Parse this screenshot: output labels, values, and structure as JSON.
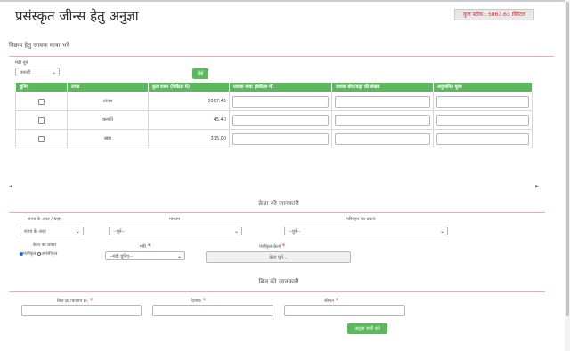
{
  "header": {
    "title": "प्रसंस्कृत जीन्स हेतु अनुज्ञा",
    "stock_badge": "कुल स्टॉक : 5867.63 क्विंटल"
  },
  "sale": {
    "section_title": "विक्रय हेतु जावक मात्रा भरें",
    "market_label": "मंडी चुनें",
    "market_value": "धमतरी",
    "show_button": "देखें",
    "columns": [
      "चुनिए",
      "उपज",
      "कुल वजन (क्विंटल में)",
      "जावक मात्रा (क्विंटल में)",
      "जावक बोरा/कट्टा की संख्या",
      "अनुमानित मूल्य"
    ],
    "rows": [
      {
        "produce": "चांवल",
        "weight": "5507.43"
      },
      {
        "produce": "कनकी",
        "weight": "45.40"
      },
      {
        "produce": "खंडा",
        "weight": "315.00"
      }
    ]
  },
  "buyer": {
    "section_title": "क्रेता की जानकारी",
    "state_label": "राज्य के अंदर / बाहर",
    "state_value": "राज्य के अंदर",
    "mode_label": "माध्यम",
    "mode_value": "--चुनें--",
    "transport_label": "परिवहन का प्रकार",
    "transport_value": "--चुनें--",
    "buyer_type_label": "क्रेता का प्रकार",
    "registered_label": "पंजीकृत",
    "unregistered_label": "अपंजीकृत",
    "market_label": "मंडी",
    "market_value": "--मंडी चुनिए--",
    "reg_buyer_label": "पंजीकृत क्रेता",
    "reg_buyer_button": "क्रेता चुनें..."
  },
  "bill": {
    "section_title": "बिल की जानकारी",
    "bill_no_label": "बिल क्र./चालान क्र.",
    "date_label": "दिनांक",
    "price_label": "कीमत",
    "submit_button": "अनुज्ञा जारी करें",
    "required_mark": "*"
  },
  "colors": {
    "accent_green": "#5cb85c",
    "required_red": "#e0242b"
  }
}
